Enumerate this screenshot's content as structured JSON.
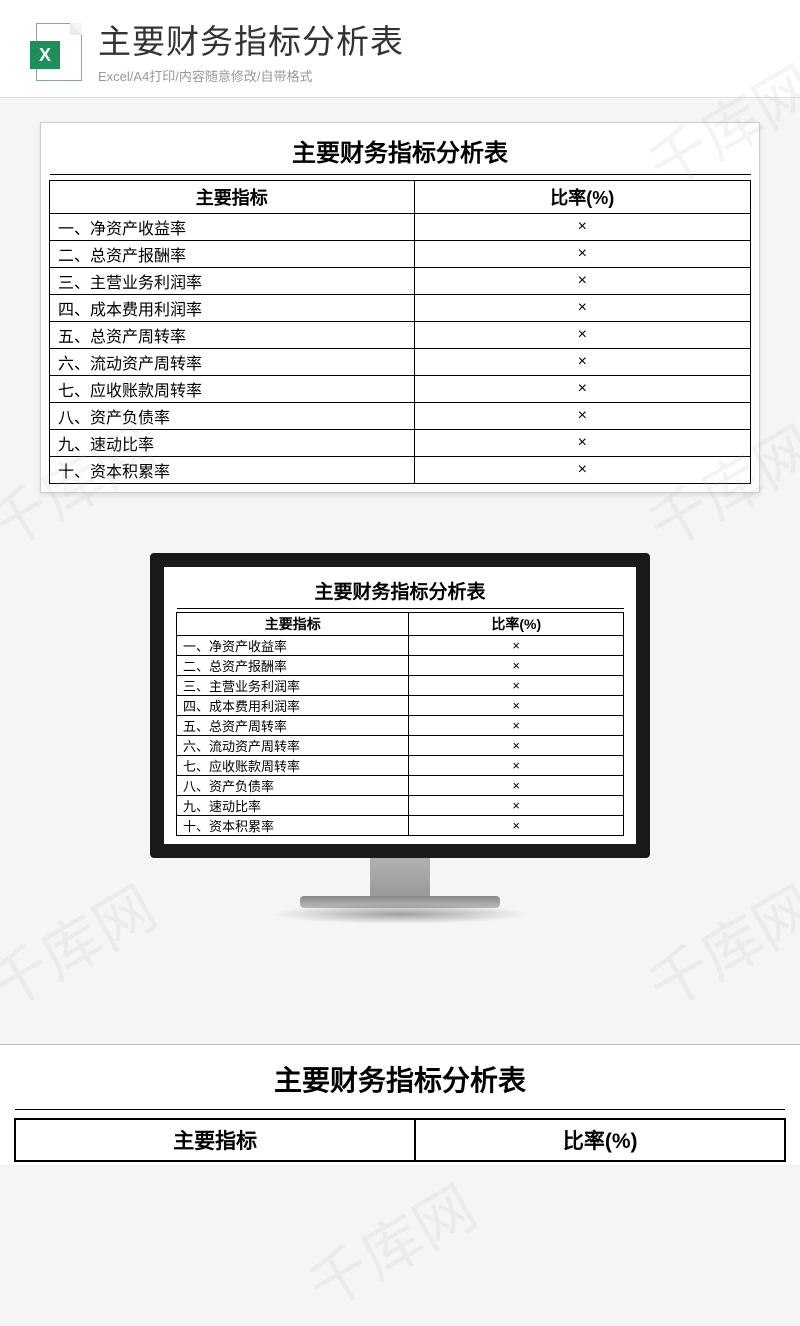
{
  "watermark": "千库网",
  "header": {
    "icon_letter": "X",
    "title": "主要财务指标分析表",
    "subtitle": "Excel/A4打印/内容随意修改/自带格式"
  },
  "table": {
    "title": "主要财务指标分析表",
    "col1_header": "主要指标",
    "col2_header": "比率(%)",
    "rows": [
      {
        "label": "一、净资产收益率",
        "value": "×"
      },
      {
        "label": "二、总资产报酬率",
        "value": "×"
      },
      {
        "label": "三、主营业务利润率",
        "value": "×"
      },
      {
        "label": "四、成本费用利润率",
        "value": "×"
      },
      {
        "label": "五、总资产周转率",
        "value": "×"
      },
      {
        "label": "六、流动资产周转率",
        "value": "×"
      },
      {
        "label": "七、应收账款周转率",
        "value": "×"
      },
      {
        "label": "八、资产负债率",
        "value": "×"
      },
      {
        "label": "九、速动比率",
        "value": "×"
      },
      {
        "label": "十、资本积累率",
        "value": "×"
      }
    ]
  }
}
